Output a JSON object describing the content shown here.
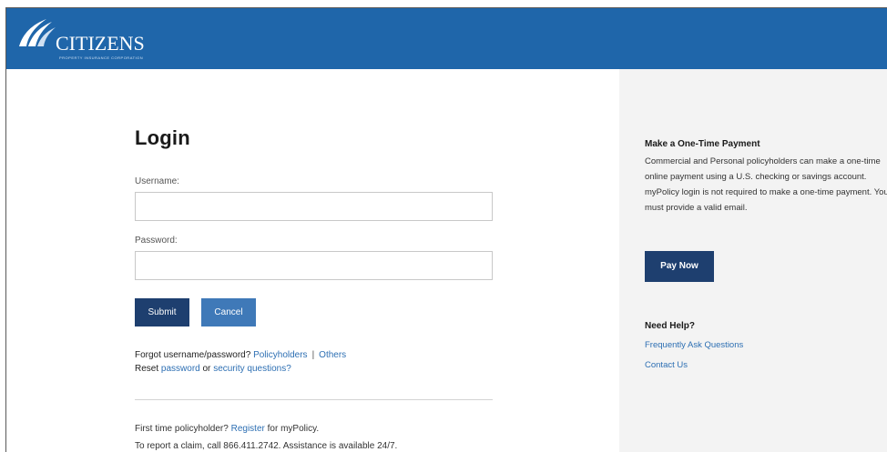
{
  "header": {
    "brand_name": "CITIZENS",
    "brand_tagline": "PROPERTY INSURANCE CORPORATION",
    "brand_color": "#1f66aa"
  },
  "login": {
    "title": "Login",
    "username_label": "Username:",
    "username_value": "",
    "password_label": "Password:",
    "password_value": "",
    "submit_label": "Submit",
    "cancel_label": "Cancel",
    "forgot_prefix": "Forgot username/password?",
    "forgot_policyholders": "Policyholders",
    "forgot_separator": "|",
    "forgot_others": "Others",
    "reset_prefix": "Reset",
    "reset_password": "password",
    "reset_or": "or",
    "reset_security": "security questions?",
    "first_time_prefix": "First time policyholder?",
    "register_link": "Register",
    "first_time_suffix": "for myPolicy.",
    "claim_text": "To report a claim, call 866.411.2742. Assistance is available 24/7."
  },
  "sidebar": {
    "payment_title": "Make a One-Time Payment",
    "payment_text": "Commercial and Personal policyholders can make a one-time online payment using a U.S. checking or savings account. myPolicy login is not required to make a one-time payment. You must provide a valid email.",
    "pay_now_label": "Pay Now",
    "help_title": "Need Help?",
    "faq_link": "Frequently Ask Questions",
    "contact_link": "Contact Us"
  },
  "colors": {
    "primary_button": "#1e3f6f",
    "secondary_button": "#3f79b8",
    "link": "#2d6fb3",
    "sidebar_bg": "#f3f3f3"
  }
}
